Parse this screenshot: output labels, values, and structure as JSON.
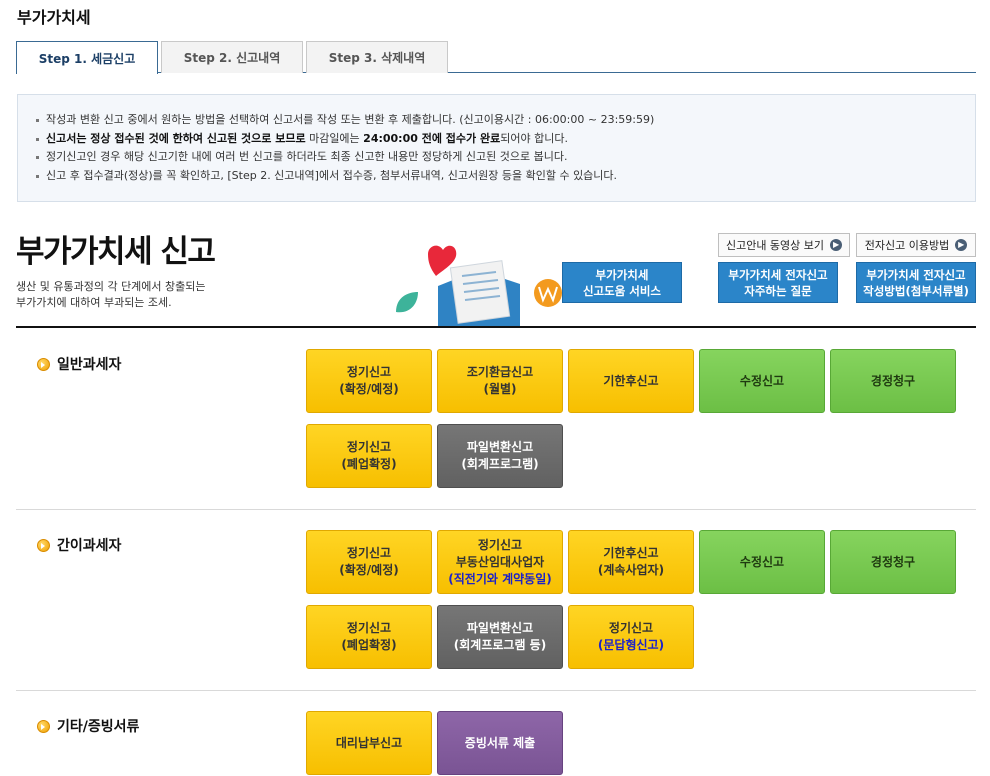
{
  "page_title": "부가가치세",
  "tabs": [
    {
      "label": "Step 1. 세금신고",
      "active": true
    },
    {
      "label": "Step 2. 신고내역",
      "active": false
    },
    {
      "label": "Step 3. 삭제내역",
      "active": false
    }
  ],
  "notice": {
    "line1": "작성과 변환 신고 중에서 원하는 방법을 선택하여 신고서를 작성 또는 변환 후 제출합니다. (신고이용시간 : 06:00:00 ~ 23:59:59)",
    "line2_a": "신고서는 정상 접수된 것에 한하여 신고된 것으로 보므로",
    "line2_b": " 마감일에는 ",
    "line2_c": "24:00:00 전에 접수가 완료",
    "line2_d": "되어야 합니다.",
    "line3": "정기신고인 경우 해당 신고기한 내에 여러 번 신고를 하더라도 최종 신고한 내용만 정당하게 신고된 것으로 봅니다.",
    "line4": "신고 후 접수결과(정상)를 꼭 확인하고, [Step 2. 신고내역]에서 접수증, 첨부서류내역, 신고서원장 등을 확인할 수 있습니다."
  },
  "hero": {
    "title": "부가가치세 신고",
    "desc_line1": "생산 및 유통과정의 각 단계에서 창출되는",
    "desc_line2": "부가가치에 대하여 부과되는 조세."
  },
  "top_buttons": {
    "video": "신고안내 동영상 보기",
    "howto": "전자신고 이용방법"
  },
  "blue_buttons": [
    {
      "line1": "부가가치세",
      "line2": "신고도움 서비스"
    },
    {
      "line1": "부가가치세 전자신고",
      "line2": "자주하는 질문"
    },
    {
      "line1": "부가가치세 전자신고",
      "line2": "작성방법(첨부서류별)"
    }
  ],
  "sections": {
    "general": {
      "label": "일반과세자",
      "buttons": {
        "regular": {
          "line1": "정기신고",
          "line2": "(확정/예정)"
        },
        "early_refund": {
          "line1": "조기환급신고",
          "line2": "(월별)"
        },
        "late": {
          "line1": "기한후신고"
        },
        "amend": {
          "line1": "수정신고"
        },
        "claim": {
          "line1": "경정청구"
        },
        "closure": {
          "line1": "정기신고",
          "line2": "(폐업확정)"
        },
        "file_convert": {
          "line1": "파일변환신고",
          "line2": "(회계프로그램)"
        }
      }
    },
    "simple": {
      "label": "간이과세자",
      "buttons": {
        "regular": {
          "line1": "정기신고",
          "line2": "(확정/예정)"
        },
        "realestate": {
          "line1": "정기신고",
          "line2": "부동산임대사업자",
          "line3": "(직전기와 계약동일)"
        },
        "late": {
          "line1": "기한후신고",
          "line2": "(계속사업자)"
        },
        "amend": {
          "line1": "수정신고"
        },
        "claim": {
          "line1": "경정청구"
        },
        "closure": {
          "line1": "정기신고",
          "line2": "(폐업확정)"
        },
        "file_convert": {
          "line1": "파일변환신고",
          "line2": "(회계프로그램 등)"
        },
        "qa": {
          "line1": "정기신고",
          "line2": "(문답형신고)"
        }
      }
    },
    "other": {
      "label": "기타/증빙서류",
      "buttons": {
        "proxy": {
          "line1": "대리납부신고"
        },
        "evidence": {
          "line1": "증빙서류 제출"
        }
      }
    }
  },
  "colors": {
    "yellow": "#f7bf00",
    "green": "#6cbf45",
    "dark_gray": "#616161",
    "purple": "#7a5494",
    "blue": "#2b85c9",
    "navy_line": "#3a6a93"
  }
}
